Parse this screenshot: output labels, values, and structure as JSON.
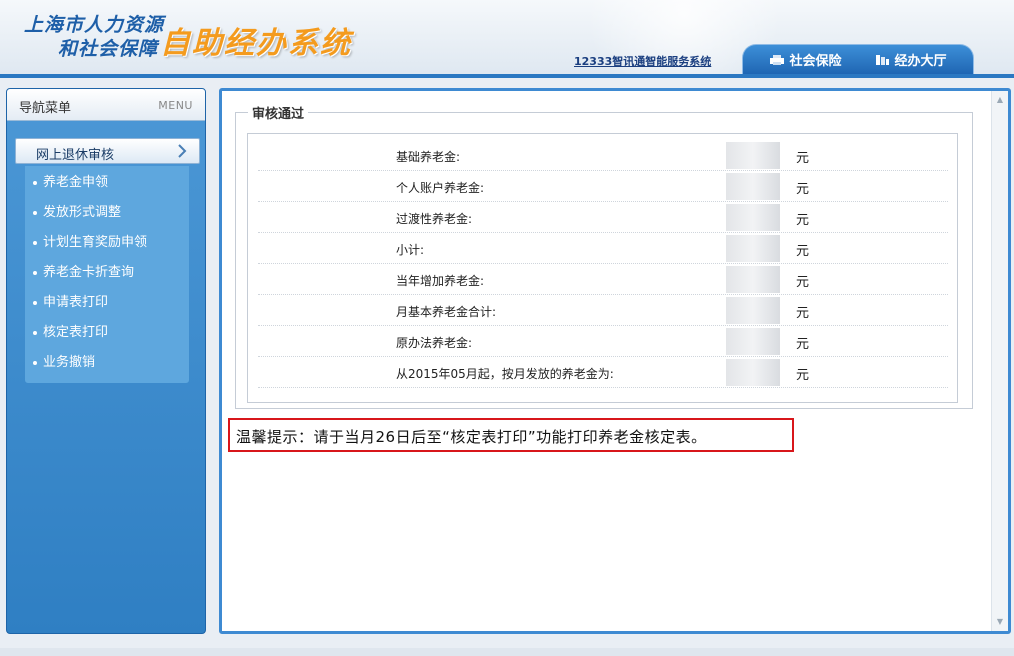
{
  "header": {
    "logo_line1": "上海市人力资源",
    "logo_line2": "和社会保障",
    "logo_main": "自助经办系统",
    "service_link": "12333智讯通智能服务系统",
    "tabs": [
      {
        "label": "社会保险",
        "icon": "printer-icon"
      },
      {
        "label": "经办大厅",
        "icon": "building-icon"
      }
    ]
  },
  "sidebar": {
    "title": "导航菜单",
    "menu_label": "MENU",
    "active_item": "网上退休审核",
    "items": [
      {
        "label": "养老金申领"
      },
      {
        "label": "发放形式调整"
      },
      {
        "label": "计划生育奖励申领"
      },
      {
        "label": "养老金卡折查询"
      },
      {
        "label": "申请表打印"
      },
      {
        "label": "核定表打印"
      },
      {
        "label": "业务撤销"
      }
    ]
  },
  "main": {
    "section_title": "审核通过",
    "rows": [
      {
        "label": "基础养老金:",
        "unit": "元"
      },
      {
        "label": "个人账户养老金:",
        "unit": "元"
      },
      {
        "label": "过渡性养老金:",
        "unit": "元"
      },
      {
        "label": "小计:",
        "unit": "元"
      },
      {
        "label": "当年增加养老金:",
        "unit": "元"
      },
      {
        "label": "月基本养老金合计:",
        "unit": "元"
      },
      {
        "label": "原办法养老金:",
        "unit": "元"
      },
      {
        "label": "从2015年05月起，按月发放的养老金为:",
        "unit": "元"
      }
    ],
    "tip": "温馨提示：请于当月26日后至“核定表打印”功能打印养老金核定表。"
  },
  "colors": {
    "accent": "#2f7fc3",
    "logo_orange": "#f49b1e",
    "tip_border": "#d8161b"
  }
}
